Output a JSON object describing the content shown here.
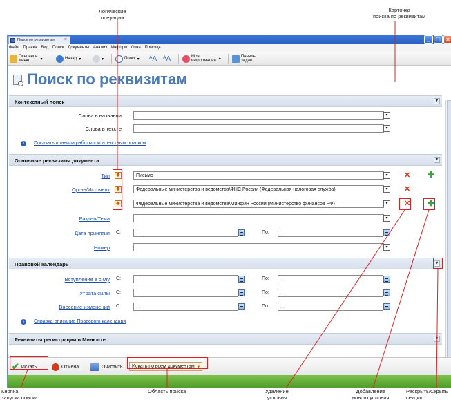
{
  "callouts": {
    "logic_ops": "Логические\nоперации",
    "card": "Карточка\nпоиска по реквизитам",
    "search_button": "Кнопка\nзапуска поиска",
    "search_area": "Область поиска",
    "remove_condition": "Удаление\nусловия",
    "add_condition": "Добавление\nнового условия",
    "toggle_section": "Раскрыть/Скрыть\nсекцию"
  },
  "window": {
    "tab_title": "Поиск по реквизитам",
    "tab_close": "×"
  },
  "menu": [
    "Файл",
    "Правка",
    "Вид",
    "Поиск",
    "Документы",
    "Анализ",
    "Информ",
    "Окна",
    "Помощь"
  ],
  "toolbar": {
    "main_menu": "Основное\nменю",
    "back": "Назад",
    "search": "Поиск",
    "my_info": "Моя\nинформация",
    "task_panel": "Панель\nзадач"
  },
  "page_title": "Поиск по реквизитам",
  "context": {
    "header": "Контекстный поиск",
    "words_in_title": "Слова в названии",
    "words_in_text": "Слова в тексте",
    "rules_link": "Показать правила работы с контекстным поиском"
  },
  "main": {
    "header": "Основные реквизиты документа",
    "type_label": "Тип",
    "type_value": "Письмо",
    "organ_label": "Орган/Источник",
    "organ_value_1": "Федеральные министерства и ведомства\\ФНС России (Федеральная налоговая служба)",
    "organ_value_2": "Федеральные министерства и ведомства\\Минфин России (Министерство финансов РФ)",
    "section_label": "Раздел/Тема",
    "date_label": "Дата принятия",
    "number_label": "Номер",
    "from": "С:",
    "to": "По:",
    "date_placeholder": ". ."
  },
  "legal": {
    "header": "Правовой календарь",
    "entry_into_force": "Вступление в силу",
    "loss_of_force": "Утрата силы",
    "amendments": "Внесение изменений",
    "help_link": "Справка-описание Правового календаря"
  },
  "ministry": {
    "header": "Реквизиты регистрации в Минюсте"
  },
  "bottom": {
    "search": "Искать",
    "cancel": "Отмена",
    "clear": "Очистить",
    "scope": "Искать по всем документам"
  },
  "colors": {
    "title_blue": "#4a79b8",
    "link_blue": "#1b4fb0",
    "highlight_red": "#e02020",
    "accent_green": "#3aa53a"
  }
}
